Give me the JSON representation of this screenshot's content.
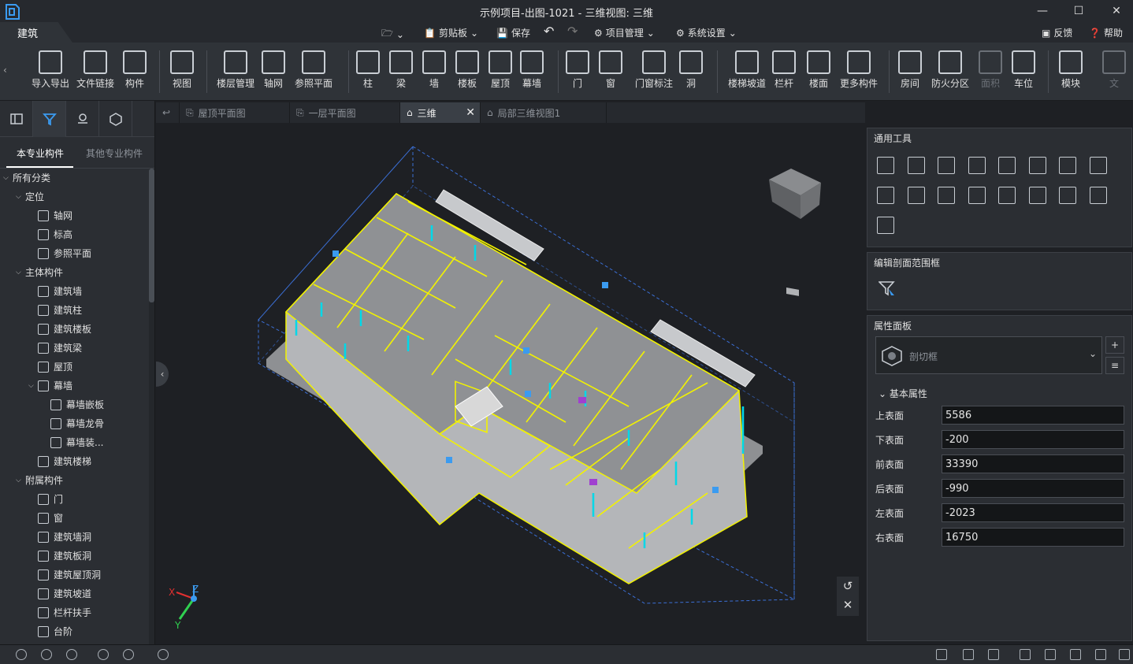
{
  "window": {
    "title": "示例项目-出图-1021 - 三维视图: 三维"
  },
  "menubar": {
    "active_tab": "建筑",
    "clipboard": "剪贴板",
    "save": "保存",
    "project": "项目管理",
    "settings": "系统设置",
    "feedback": "反馈",
    "help": "帮助"
  },
  "ribbon": [
    {
      "label": "导入导出",
      "icon": "cad-import-icon"
    },
    {
      "label": "文件链接",
      "icon": "file-link-icon"
    },
    {
      "label": "构件",
      "icon": "component-icon"
    },
    {
      "label": "视图",
      "icon": "view-icon"
    },
    {
      "label": "楼层管理",
      "icon": "floor-management-icon"
    },
    {
      "label": "轴网",
      "icon": "axis-grid-icon"
    },
    {
      "label": "参照平面",
      "icon": "reference-plane-icon"
    },
    {
      "label": "柱",
      "icon": "column-icon"
    },
    {
      "label": "梁",
      "icon": "beam-icon"
    },
    {
      "label": "墙",
      "icon": "wall-icon"
    },
    {
      "label": "楼板",
      "icon": "slab-icon"
    },
    {
      "label": "屋顶",
      "icon": "roof-icon"
    },
    {
      "label": "幕墙",
      "icon": "curtain-wall-icon"
    },
    {
      "label": "门",
      "icon": "door-icon"
    },
    {
      "label": "窗",
      "icon": "window-icon"
    },
    {
      "label": "门窗标注",
      "icon": "door-window-tag-icon"
    },
    {
      "label": "洞",
      "icon": "opening-icon"
    },
    {
      "label": "楼梯坡道",
      "icon": "stair-ramp-icon"
    },
    {
      "label": "栏杆",
      "icon": "railing-icon"
    },
    {
      "label": "楼面",
      "icon": "floor-surface-icon"
    },
    {
      "label": "更多构件",
      "icon": "more-components-icon"
    },
    {
      "label": "房间",
      "icon": "room-icon"
    },
    {
      "label": "防火分区",
      "icon": "fire-zone-icon"
    },
    {
      "label": "面积",
      "icon": "area-icon",
      "disabled": true
    },
    {
      "label": "车位",
      "icon": "parking-icon"
    },
    {
      "label": "模块",
      "icon": "module-icon"
    },
    {
      "label": "文",
      "icon": "text-icon",
      "disabled": true
    }
  ],
  "left_panel": {
    "tabs": [
      "本专业构件",
      "其他专业构件"
    ],
    "tree": [
      {
        "label": "所有分类",
        "level": 0,
        "caret": true
      },
      {
        "label": "定位",
        "level": 1,
        "caret": true
      },
      {
        "label": "轴网",
        "level": 2
      },
      {
        "label": "标高",
        "level": 2
      },
      {
        "label": "参照平面",
        "level": 2
      },
      {
        "label": "主体构件",
        "level": 1,
        "caret": true
      },
      {
        "label": "建筑墙",
        "level": 2
      },
      {
        "label": "建筑柱",
        "level": 2
      },
      {
        "label": "建筑楼板",
        "level": 2
      },
      {
        "label": "建筑梁",
        "level": 2
      },
      {
        "label": "屋顶",
        "level": 2
      },
      {
        "label": "幕墙",
        "level": 2,
        "caret": true
      },
      {
        "label": "幕墙嵌板",
        "level": 3
      },
      {
        "label": "幕墙龙骨",
        "level": 3
      },
      {
        "label": "幕墙装...",
        "level": 3
      },
      {
        "label": "建筑楼梯",
        "level": 2
      },
      {
        "label": "附属构件",
        "level": 1,
        "caret": true
      },
      {
        "label": "门",
        "level": 2
      },
      {
        "label": "窗",
        "level": 2
      },
      {
        "label": "建筑墙洞",
        "level": 2
      },
      {
        "label": "建筑板洞",
        "level": 2
      },
      {
        "label": "建筑屋顶洞",
        "level": 2
      },
      {
        "label": "建筑坡道",
        "level": 2
      },
      {
        "label": "栏杆扶手",
        "level": 2
      },
      {
        "label": "台阶",
        "level": 2
      }
    ]
  },
  "doc_tabs": [
    {
      "label": "屋顶平面图",
      "active": false
    },
    {
      "label": "一层平面图",
      "active": false
    },
    {
      "label": "三维",
      "active": true
    },
    {
      "label": "局部三维视图1",
      "active": false
    }
  ],
  "axis": {
    "x": "X",
    "y": "Y",
    "z": "Z"
  },
  "tools_panel": {
    "title": "通用工具"
  },
  "section_panel": {
    "title": "编辑剖面范围框"
  },
  "props_panel": {
    "title": "属性面板",
    "type_name": "剖切框",
    "group": "基本属性",
    "rows": [
      {
        "label": "上表面",
        "value": "5586"
      },
      {
        "label": "下表面",
        "value": "-200"
      },
      {
        "label": "前表面",
        "value": "33390"
      },
      {
        "label": "后表面",
        "value": "-990"
      },
      {
        "label": "左表面",
        "value": "-2023"
      },
      {
        "label": "右表面",
        "value": "16750"
      }
    ]
  },
  "colors": {
    "accent": "#2f8ee6",
    "building_edge": "#f2f200",
    "window": "#00d8e8",
    "slab": "#9a9c9f"
  }
}
